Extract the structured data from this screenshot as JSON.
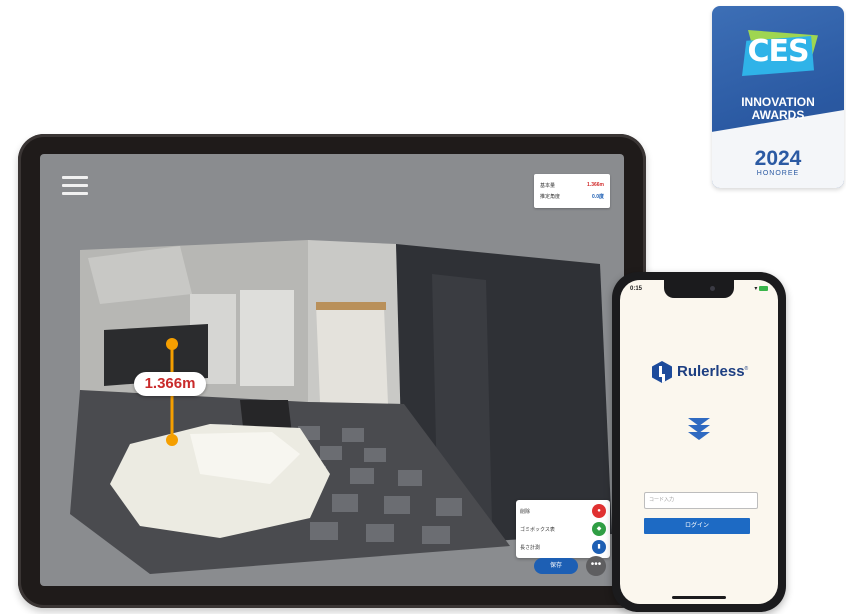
{
  "ces_badge": {
    "logo": "CES",
    "line1": "INNOVATION",
    "line2": "AWARDS",
    "year": "2024",
    "subtitle": "HONOREE"
  },
  "tablet": {
    "menu_icon": "hamburger-icon",
    "info_card": {
      "rows": [
        {
          "label": "基本量",
          "value": "1.366m",
          "color": "#d12b2b"
        },
        {
          "label": "推定角度",
          "value": "0.0度",
          "color": "#1d5fb4"
        }
      ]
    },
    "measurement": "1.366m",
    "tools": [
      {
        "label": "削除",
        "color": "#e03131",
        "icon": "delete-icon"
      },
      {
        "label": "ゴミボックス表",
        "color": "#2f9e44",
        "icon": "box-icon"
      },
      {
        "label": "長さ計測",
        "color": "#1d5fb4",
        "icon": "ruler-icon"
      }
    ],
    "primary_button": "保存",
    "more_button": "•••"
  },
  "phone": {
    "status_time": "0:15",
    "brand_name": "Rulerless",
    "brand_mark": "®",
    "input_placeholder": "コード入力",
    "login_button": "ログイン"
  }
}
